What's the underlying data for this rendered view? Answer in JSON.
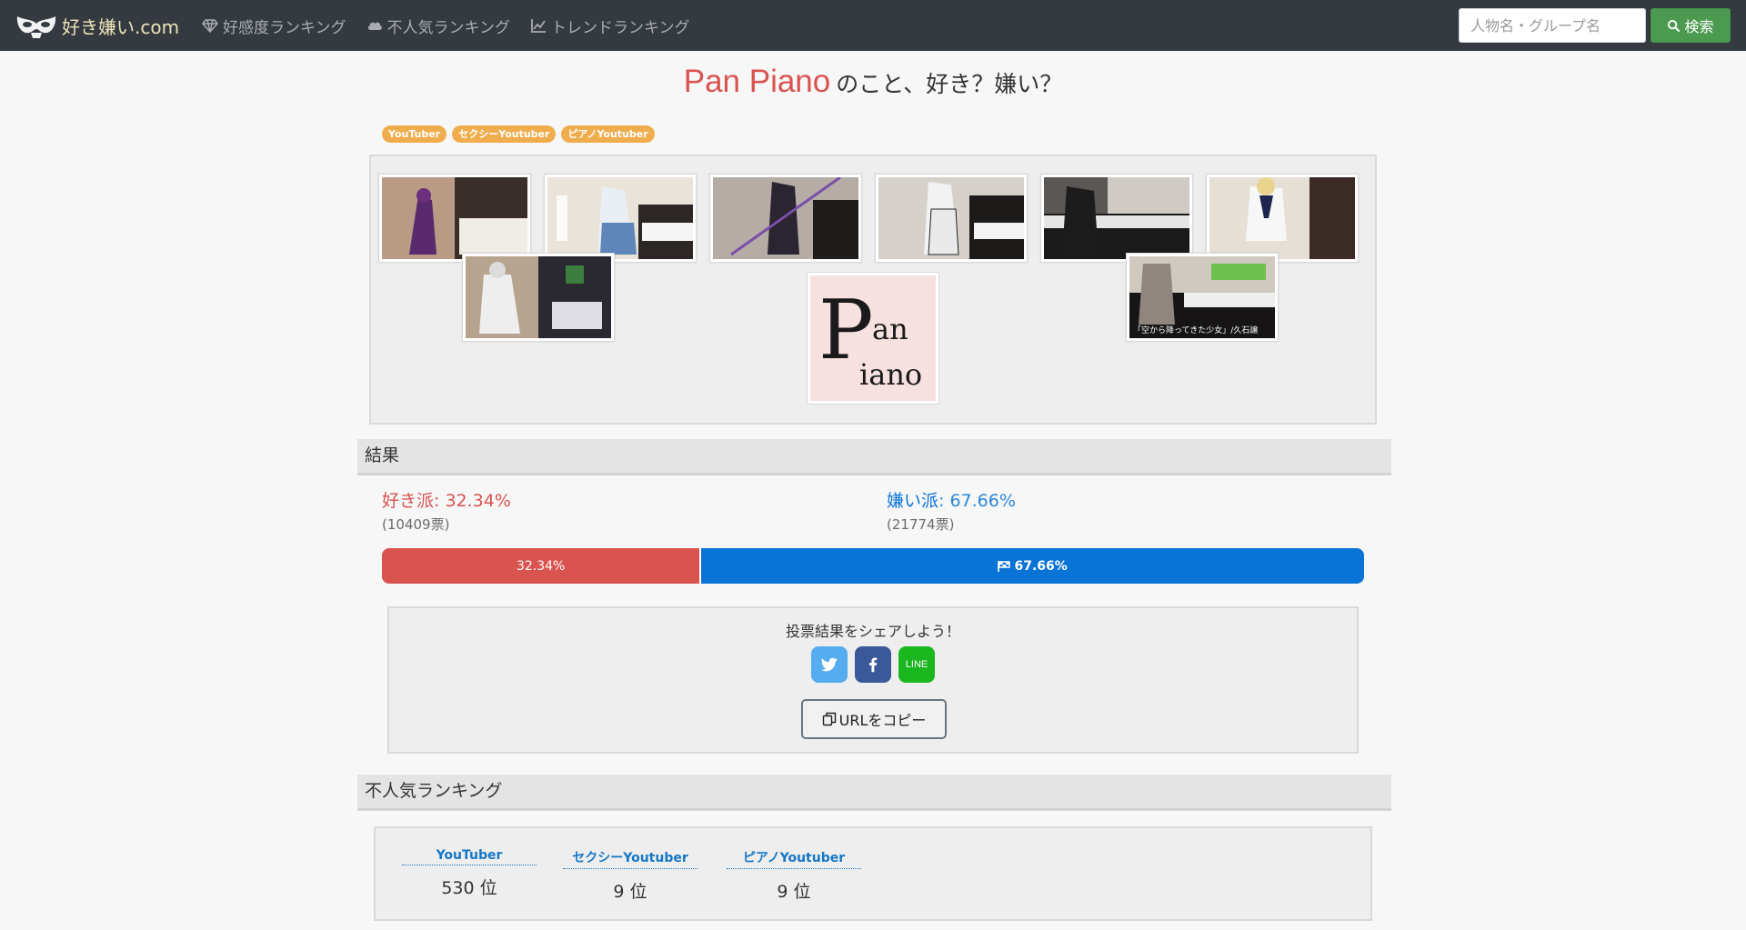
{
  "navbar": {
    "brand": "好き嫌い.com",
    "links": [
      {
        "label": "好感度ランキング",
        "icon": "diamond-icon"
      },
      {
        "label": "不人気ランキング",
        "icon": "cloud-icon"
      },
      {
        "label": "トレンドランキング",
        "icon": "line-chart-icon"
      }
    ],
    "search_placeholder": "人物名・グループ名",
    "search_button": "検索"
  },
  "page": {
    "title_name": "Pan Piano",
    "title_rest": "のこと、好き？嫌い？",
    "tags": [
      "YouTuber",
      "セクシーYoutuber",
      "ピアノYoutuber"
    ]
  },
  "gallery": {
    "logo": {
      "p": "P",
      "an": "an",
      "iano": "iano"
    },
    "captions": [
      "「空から降ってきた少女」/久石譲"
    ]
  },
  "result": {
    "header": "結果",
    "like_label": "好き派",
    "like_percent": "32.34%",
    "like_votes": "(10409票)",
    "dislike_label": "嫌い派",
    "dislike_percent": "67.66%",
    "dislike_votes": "(21774票)",
    "like_fraction": 0.3234,
    "bar_like_text": "32.34%",
    "bar_dislike_text": "67.66%",
    "colors": {
      "like": "#d9534f",
      "dislike": "#0a73d6"
    }
  },
  "share": {
    "text": "投票結果をシェアしよう！",
    "icons": [
      "twitter-icon",
      "facebook-icon",
      "line-icon"
    ],
    "line_label": "LINE",
    "copy_button": "URLをコピー"
  },
  "ranking": {
    "header": "不人気ランキング",
    "items": [
      {
        "label": "YouTuber",
        "rank": "530 位"
      },
      {
        "label": "セクシーYoutuber",
        "rank": "9 位"
      },
      {
        "label": "ピアノYoutuber",
        "rank": "9 位"
      }
    ]
  }
}
